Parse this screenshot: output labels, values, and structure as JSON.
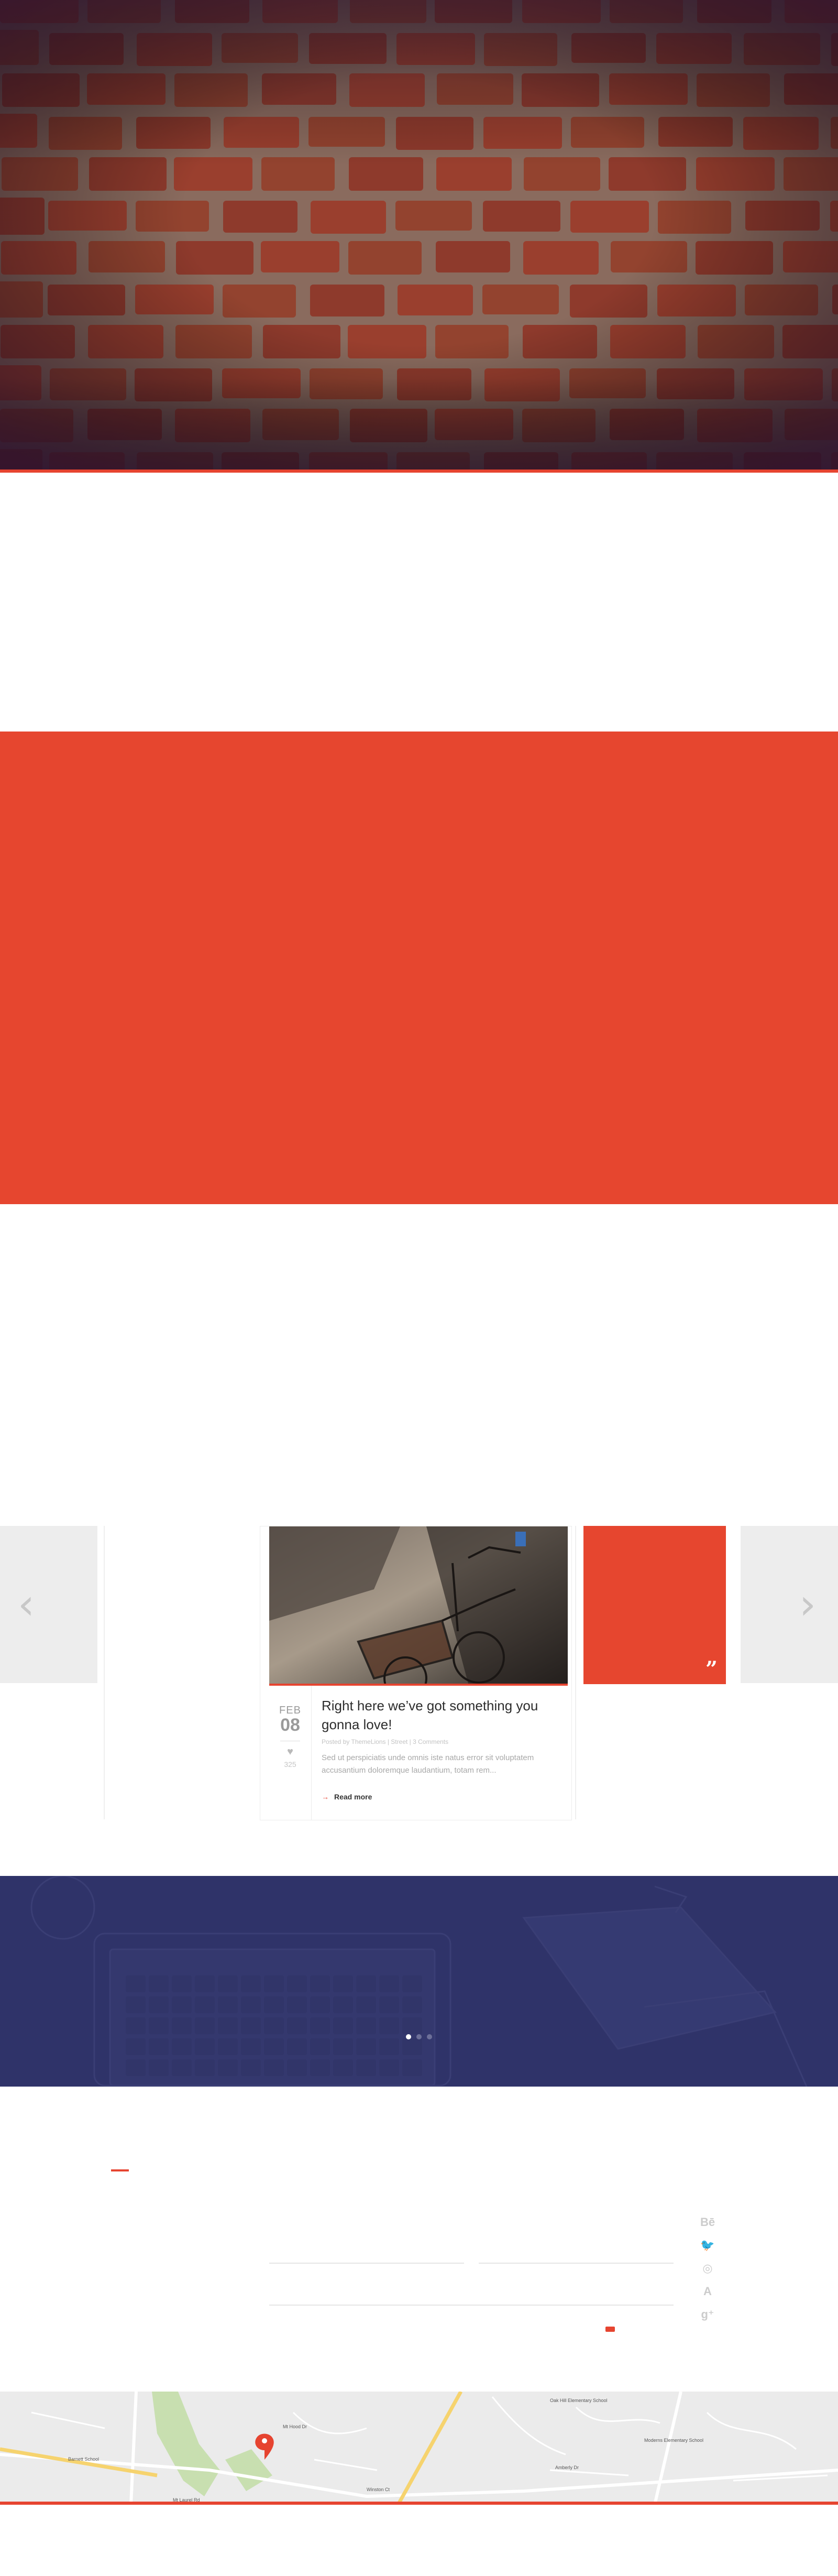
{
  "colors": {
    "accent": "#e64430",
    "red_band": "#e6462f",
    "blue_band": "#2f3369",
    "text_dark": "#2d2d2d",
    "text_muted": "#a8a8a8"
  },
  "hero": {
    "background": "brick wall photograph"
  },
  "carousel": {
    "prev_icon": "chevron-left-icon",
    "next_icon": "chevron-right-icon",
    "post": {
      "month": "FEB",
      "day": "08",
      "like_icon": "heart-icon",
      "likes": "325",
      "title": "Right here we’ve got something you gonna love!",
      "meta": "Posted by ThemeLions | Street | 3 Comments",
      "excerpt": "Sed ut perspiciatis unde omnis iste natus error sit voluptatem accusantium doloremque laudantium, totam rem...",
      "read_more": "Read more"
    },
    "quote_icon": "quote-icon"
  },
  "testimonials": {
    "dots": [
      true,
      false,
      false
    ]
  },
  "contact": {
    "social": [
      {
        "icon": "behance-icon",
        "glyph": "Bē"
      },
      {
        "icon": "twitter-icon",
        "glyph": "🐦"
      },
      {
        "icon": "dribbble-icon",
        "glyph": "◎"
      },
      {
        "icon": "app-icon",
        "glyph": "A"
      },
      {
        "icon": "google-plus-icon",
        "glyph": "g⁺"
      }
    ]
  },
  "map": {
    "labels": [
      "Barnett School",
      "Mt Hood Dr",
      "Amberly Dr",
      "Winston Ct",
      "Moderns Elementary School",
      "Oak Hill Elementary School",
      "Mt Laurel Rd"
    ]
  }
}
